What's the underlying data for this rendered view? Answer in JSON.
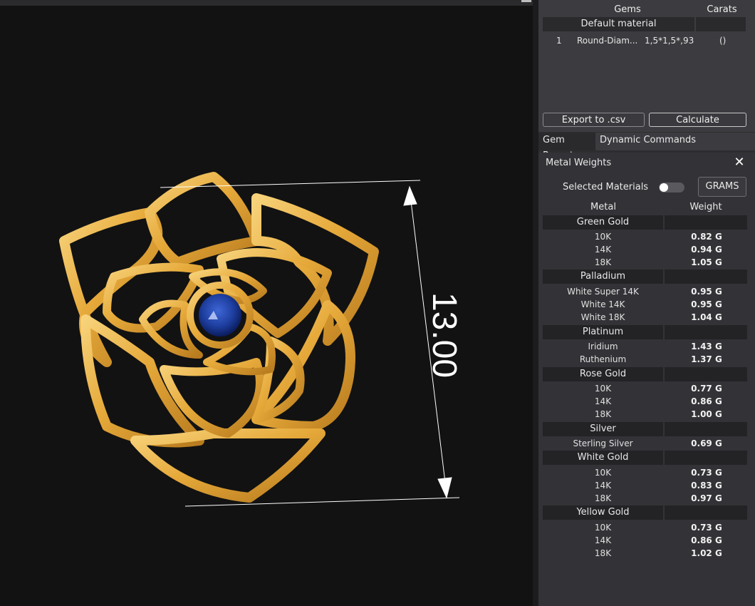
{
  "viewport": {
    "dimension_label": "13.00",
    "gold_color": "#e6a93a",
    "gem_color": "#1e3fa0"
  },
  "gems_panel": {
    "col_gems": "Gems",
    "col_carats": "Carats",
    "group": "Default material",
    "rows": [
      {
        "index": "1",
        "name": "Round-Diam...",
        "size": "1,5*1,5*,93",
        "carats": "()"
      }
    ],
    "export_label": "Export to .csv",
    "calculate_label": "Calculate"
  },
  "tabs": {
    "gem_report": "Gem Report",
    "dynamic_commands": "Dynamic Commands"
  },
  "metal_weights": {
    "title": "Metal Weights",
    "selected_materials_label": "Selected Materials",
    "selected_materials_on": false,
    "units_label": "GRAMS",
    "col_metal": "Metal",
    "col_weight": "Weight",
    "groups": [
      {
        "name": "Green Gold",
        "items": [
          {
            "name": "10K",
            "weight": "0.82 G"
          },
          {
            "name": "14K",
            "weight": "0.94 G"
          },
          {
            "name": "18K",
            "weight": "1.05 G"
          }
        ]
      },
      {
        "name": "Palladium",
        "items": [
          {
            "name": "White Super 14K",
            "weight": "0.95 G"
          },
          {
            "name": "White 14K",
            "weight": "0.95 G"
          },
          {
            "name": "White 18K",
            "weight": "1.04 G"
          }
        ]
      },
      {
        "name": "Platinum",
        "items": [
          {
            "name": "Iridium",
            "weight": "1.43 G"
          },
          {
            "name": "Ruthenium",
            "weight": "1.37 G"
          }
        ]
      },
      {
        "name": "Rose Gold",
        "items": [
          {
            "name": "10K",
            "weight": "0.77 G"
          },
          {
            "name": "14K",
            "weight": "0.86 G"
          },
          {
            "name": "18K",
            "weight": "1.00 G"
          }
        ]
      },
      {
        "name": "Silver",
        "items": [
          {
            "name": "Sterling Silver",
            "weight": "0.69 G"
          }
        ]
      },
      {
        "name": "White Gold",
        "items": [
          {
            "name": "10K",
            "weight": "0.73 G"
          },
          {
            "name": "14K",
            "weight": "0.83 G"
          },
          {
            "name": "18K",
            "weight": "0.97 G"
          }
        ]
      },
      {
        "name": "Yellow Gold",
        "items": [
          {
            "name": "10K",
            "weight": "0.73 G"
          },
          {
            "name": "14K",
            "weight": "0.86 G"
          },
          {
            "name": "18K",
            "weight": "1.02 G"
          }
        ]
      }
    ]
  }
}
